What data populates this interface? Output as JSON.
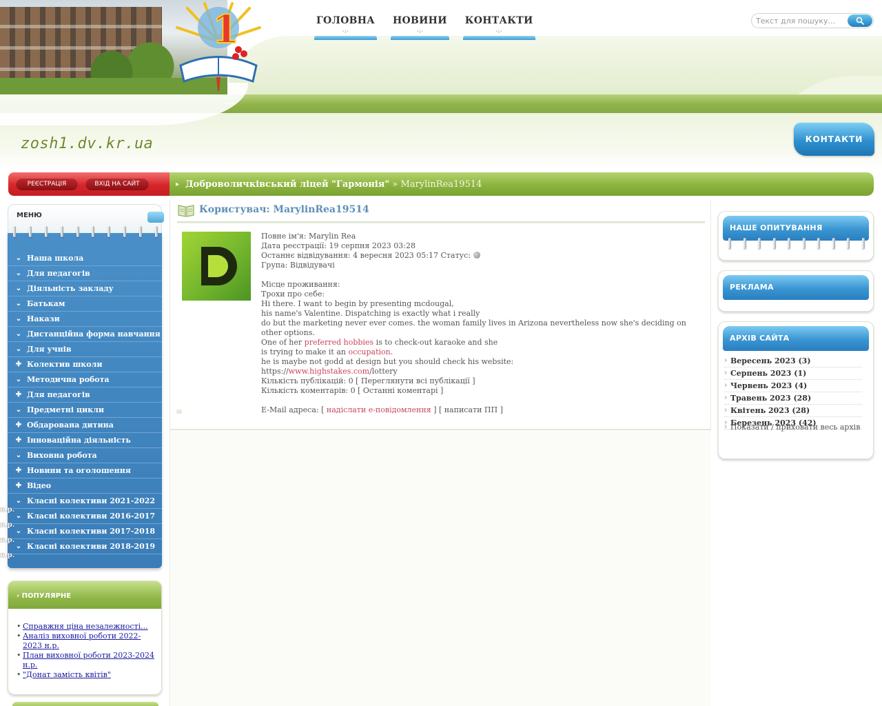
{
  "site": {
    "url_text": "zosh1.dv.kr.ua",
    "contacts_button": "КОНТАКТИ"
  },
  "top_nav": [
    {
      "label": "ГОЛОВНА"
    },
    {
      "label": "НОВИНИ"
    },
    {
      "label": "КОНТАКТИ"
    }
  ],
  "search": {
    "placeholder": "Текст для пошуку..."
  },
  "login_bar": {
    "register": "РЕЄСТРАЦІЯ",
    "login": "ВХІД НА САЙТ"
  },
  "breadcrumb": {
    "home": "Доброволичківський ліцей \"Гармонія\"",
    "separator": "»",
    "current": "MarylinRea19514"
  },
  "menu": {
    "title": "МЕНЮ",
    "items": [
      {
        "label": "Наша школа",
        "icon": "chevron-down-icon",
        "suffix": ""
      },
      {
        "label": "Для педагогів",
        "icon": "chevron-down-icon",
        "suffix": ""
      },
      {
        "label": "Діяльність закладу",
        "icon": "chevron-down-icon",
        "suffix": ""
      },
      {
        "label": "Батькам",
        "icon": "chevron-down-icon",
        "suffix": ""
      },
      {
        "label": "Накази",
        "icon": "chevron-down-icon",
        "suffix": ""
      },
      {
        "label": "Дистанційна форма навчання",
        "icon": "chevron-down-icon",
        "suffix": ""
      },
      {
        "label": "Для учнів",
        "icon": "chevron-down-icon",
        "suffix": ""
      },
      {
        "label": "Колектив школи",
        "icon": "plus-icon",
        "suffix": ""
      },
      {
        "label": "Методична робота",
        "icon": "chevron-down-icon",
        "suffix": ""
      },
      {
        "label": "Для педагогів",
        "icon": "plus-icon",
        "suffix": ""
      },
      {
        "label": "Предметні цикли",
        "icon": "chevron-down-icon",
        "suffix": ""
      },
      {
        "label": "Обдарована дитина",
        "icon": "plus-icon",
        "suffix": ""
      },
      {
        "label": "Інноваційна діяльність",
        "icon": "plus-icon",
        "suffix": ""
      },
      {
        "label": "Виховна робота",
        "icon": "chevron-down-icon",
        "suffix": ""
      },
      {
        "label": "Новини та оголошення",
        "icon": "plus-icon",
        "suffix": ""
      },
      {
        "label": "Відео",
        "icon": "plus-icon",
        "suffix": ""
      },
      {
        "label": "Класні колективи 2021-2022",
        "icon": "chevron-down-icon",
        "suffix": "н.р."
      },
      {
        "label": "Класні колективи 2016-2017",
        "icon": "chevron-down-icon",
        "suffix": "н.р."
      },
      {
        "label": "Класні колективи 2017-2018",
        "icon": "chevron-down-icon",
        "suffix": "н.р."
      },
      {
        "label": "Класні колективи 2018-2019",
        "icon": "chevron-down-icon",
        "suffix": "н.р."
      }
    ]
  },
  "popular": {
    "title": "ПОПУЛЯРНЕ",
    "items": [
      {
        "label": "Справжня ціна незалежності..."
      },
      {
        "label": "Аналіз виховної роботи 2022-2023 н.р."
      },
      {
        "label": "План виховної роботи 2023-2024 н.р."
      },
      {
        "label": "\"Донат замість квітів\""
      }
    ]
  },
  "profile": {
    "title": "Користувач: MarylinRea19514",
    "full_name": "Повне ім'я: Marylin Rea",
    "registered": "Дата реєстрації: 19 серпня 2023 03:28",
    "last_visit": "Останнє відвідування: 4 вересня 2023 05:17 Статус:",
    "group": "Група: Відвідувачі",
    "residence": "Місце проживання:",
    "about_label": "Трохи про себе:",
    "about_1": "Hi there. I want to begin by presenting mcdougal,",
    "about_2": "his name's Valentine. Dispatching is exactly what i really",
    "about_3": "do but the marketing never ever comes. the woman family lives in Arizona nevertheless now she's deciding on other options.",
    "about_4_pre": "One of her ",
    "about_4_link": "preferred hobbies",
    "about_4_post": " is to check-out karaoke and she",
    "about_5_pre": "is trying to make it an ",
    "about_5_link": "occupation",
    "about_5_post": ".",
    "about_6": "he is maybe not godd at design but you should check his website:",
    "website_pre": "https://",
    "website_link": "www.highstakes.com",
    "website_post": "/lottery",
    "publications": "Кількість публікацій: 0 [ Переглянути всі публікації ]",
    "comments": "Кількість коментарів: 0 [ Останні коментарі ]",
    "email_pre": "E-Mail адреса: [ ",
    "email_link": "надіслати e-повідомлення",
    "email_post": " ] [ написати ПП ]"
  },
  "right": {
    "poll_title": "НАШЕ ОПИТУВАННЯ",
    "ad_title": "РЕКЛАМА",
    "archive_title": "АРХІВ САЙТА",
    "archive_items": [
      {
        "label": "Вересень 2023 (3)"
      },
      {
        "label": "Серпень 2023 (1)"
      },
      {
        "label": "Червень 2023 (4)"
      },
      {
        "label": "Травень 2023 (28)"
      },
      {
        "label": "Квітень 2023 (28)"
      },
      {
        "label": "Березень 2023 (42)"
      }
    ],
    "archive_toggle": "Показати / приховати весь архів"
  },
  "colors": {
    "menu_blue": "#3a7db8",
    "breadcrumb_green": "#8cb33e",
    "login_red": "#d6262a",
    "link_red": "#c9455a",
    "title_blue": "#5c8fb8"
  }
}
